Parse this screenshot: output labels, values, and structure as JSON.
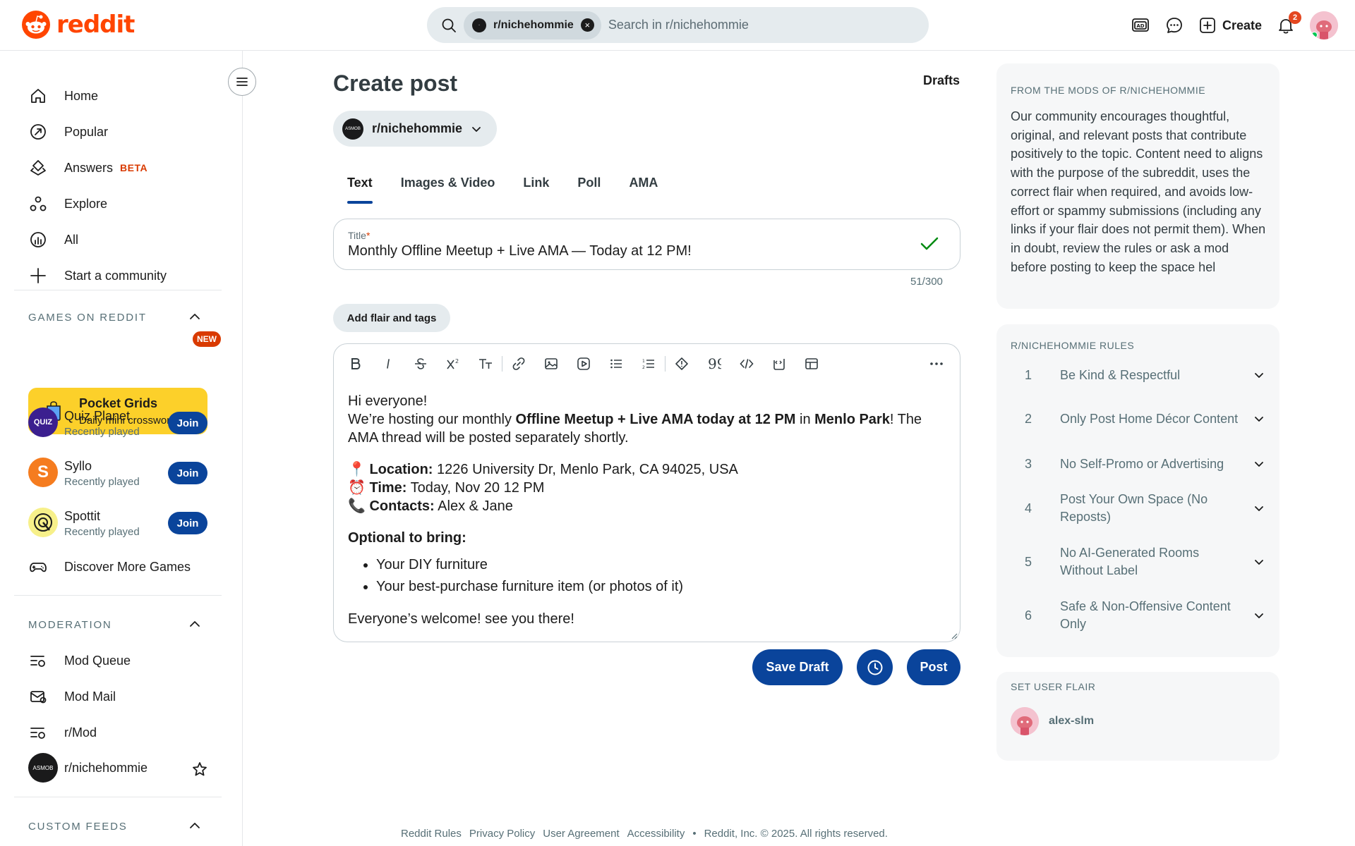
{
  "header": {
    "logo_text": "reddit",
    "search_chip": "r/nichehommie",
    "search_placeholder": "Search in r/nichehommie",
    "create_label": "Create",
    "notification_count": "2"
  },
  "sidebar": {
    "nav": [
      {
        "label": "Home",
        "icon": "home-icon"
      },
      {
        "label": "Popular",
        "icon": "popular-icon"
      },
      {
        "label": "Answers",
        "icon": "answers-icon",
        "badge": "BETA"
      },
      {
        "label": "Explore",
        "icon": "explore-icon"
      },
      {
        "label": "All",
        "icon": "all-icon"
      },
      {
        "label": "Start a community",
        "icon": "plus-icon"
      }
    ],
    "games_title": "GAMES ON REDDIT",
    "pocket": {
      "title": "Pocket Grids",
      "subtitle": "Daily mini crosswords",
      "badge": "NEW"
    },
    "games": [
      {
        "name": "Quiz Planet",
        "subtitle": "Recently played",
        "join": "Join",
        "icon_text": "QUIZ"
      },
      {
        "name": "Syllo",
        "subtitle": "Recently played",
        "join": "Join",
        "icon_text": "S"
      },
      {
        "name": "Spottit",
        "subtitle": "Recently played",
        "join": "Join",
        "icon_text": ""
      }
    ],
    "discover_label": "Discover More Games",
    "moderation_title": "MODERATION",
    "moderation": [
      {
        "label": "Mod Queue"
      },
      {
        "label": "Mod Mail"
      },
      {
        "label": "r/Mod"
      },
      {
        "label": "r/nichehommie"
      }
    ],
    "custom_feeds_title": "CUSTOM FEEDS"
  },
  "main": {
    "title": "Create post",
    "drafts_label": "Drafts",
    "subreddit": "r/nichehommie",
    "sub_avatar_text": "ASMOB",
    "tabs": [
      "Text",
      "Images & Video",
      "Link",
      "Poll",
      "AMA"
    ],
    "active_tab": "Text",
    "title_label": "Title",
    "title_required": "*",
    "title_value": "Monthly Offline Meetup + Live AMA — Today at 12 PM!",
    "char_count": "51/300",
    "flair_button": "Add flair and tags",
    "body": {
      "greeting": "Hi everyone!",
      "intro_1": "We’re hosting our monthly ",
      "intro_bold_1": "Offline Meetup + Live AMA today at 12 PM",
      "intro_2": " in ",
      "intro_bold_2": "Menlo Park",
      "intro_3": "! The AMA thread will be posted separately shortly.",
      "location_emoji": "📍",
      "location_label": "Location:",
      "location_value": " 1226 University Dr, Menlo Park, CA 94025, USA",
      "time_emoji": "⏰",
      "time_label": "Time:",
      "time_value": " Today, Nov 20 12 PM",
      "contacts_emoji": "📞",
      "contacts_label": "Contacts:",
      "contacts_value": " Alex & Jane",
      "optional_heading": "Optional to bring:",
      "bring_items": [
        "Your DIY furniture",
        "Your best-purchase furniture item (or photos of it)"
      ],
      "closing": "Everyone’s welcome! see you there!"
    },
    "save_draft": "Save Draft",
    "post": "Post"
  },
  "right": {
    "mods_title": "FROM THE MODS OF R/NICHEHOMMIE",
    "mods_body": "Our community encourages thoughtful, original, and relevant posts that contribute positively to the topic. Content need to aligns with the purpose of the subreddit, uses the correct flair when required, and avoids low-effort or spammy submissions (including any links if your flair does not permit them). When in doubt, review the rules or ask a mod before posting to keep the space hel",
    "rules_title": "R/NICHEHOMMIE RULES",
    "rules": [
      {
        "num": "1",
        "text": "Be Kind & Respectful"
      },
      {
        "num": "2",
        "text": "Only Post Home Décor Content"
      },
      {
        "num": "3",
        "text": "No Self-Promo or Advertising"
      },
      {
        "num": "4",
        "text": "Post Your Own Space (No Reposts)"
      },
      {
        "num": "5",
        "text": "No AI-Generated Rooms Without Label"
      },
      {
        "num": "6",
        "text": "Safe & Non-Offensive Content Only"
      }
    ],
    "flair_title": "SET USER FLAIR",
    "flair_user": "alex-slm"
  },
  "footer": {
    "links": [
      "Reddit Rules",
      "Privacy Policy",
      "User Agreement",
      "Accessibility"
    ],
    "separator": "•",
    "copyright": "Reddit, Inc. © 2025. All rights reserved."
  },
  "colors": {
    "brand": "#ff4500",
    "primary_button": "#0a449b",
    "pocket_yellow": "#fcd02a",
    "badge_red": "#d93a00"
  }
}
